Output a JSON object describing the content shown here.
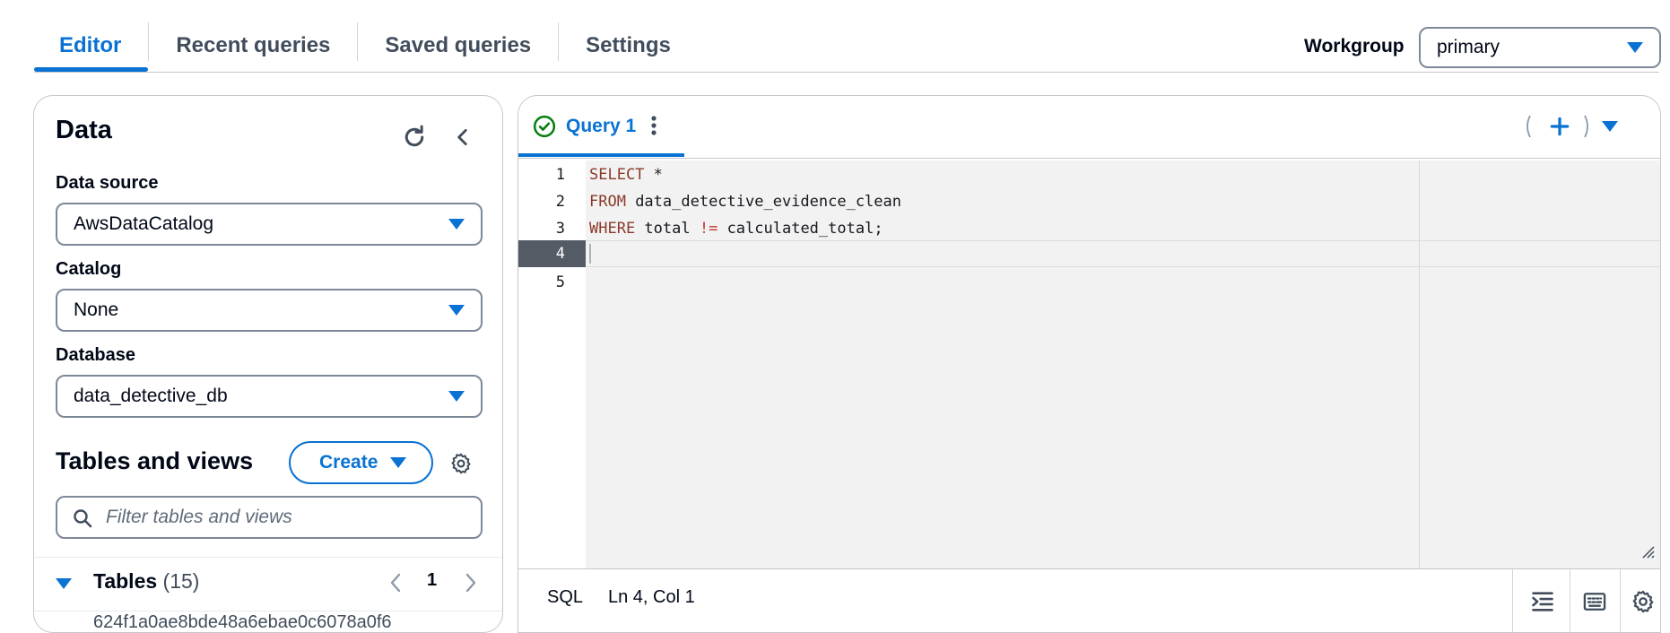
{
  "tabs": [
    {
      "label": "Editor",
      "active": true
    },
    {
      "label": "Recent queries",
      "active": false
    },
    {
      "label": "Saved queries",
      "active": false
    },
    {
      "label": "Settings",
      "active": false
    }
  ],
  "workgroup": {
    "label": "Workgroup",
    "value": "primary"
  },
  "data_panel": {
    "title": "Data",
    "data_source": {
      "label": "Data source",
      "value": "AwsDataCatalog"
    },
    "catalog": {
      "label": "Catalog",
      "value": "None"
    },
    "database": {
      "label": "Database",
      "value": "data_detective_db"
    },
    "tables_section": {
      "title": "Tables and views",
      "create_label": "Create",
      "filter_placeholder": "Filter tables and views",
      "tables_label": "Tables",
      "tables_count": "(15)",
      "page": "1",
      "partial_item": "624f1a0ae8bde48a6ebae0c6078a0f6"
    }
  },
  "editor": {
    "query_tab": "Query 1",
    "status": "success",
    "line_numbers": [
      "1",
      "2",
      "3",
      "4",
      "5"
    ],
    "lines": [
      {
        "kw": "SELECT",
        "rest": " *"
      },
      {
        "kw": "FROM",
        "rest": " data_detective_evidence_clean"
      },
      {
        "kw": "WHERE",
        "rest_a": " total ",
        "op": "!=",
        "rest_b": " calculated_total;"
      }
    ],
    "status_bar": {
      "language": "SQL",
      "position": "Ln 4, Col 1"
    }
  },
  "colors": {
    "accent": "#0972d3",
    "success": "#037f0c",
    "keyword": "#8b3a2b"
  }
}
